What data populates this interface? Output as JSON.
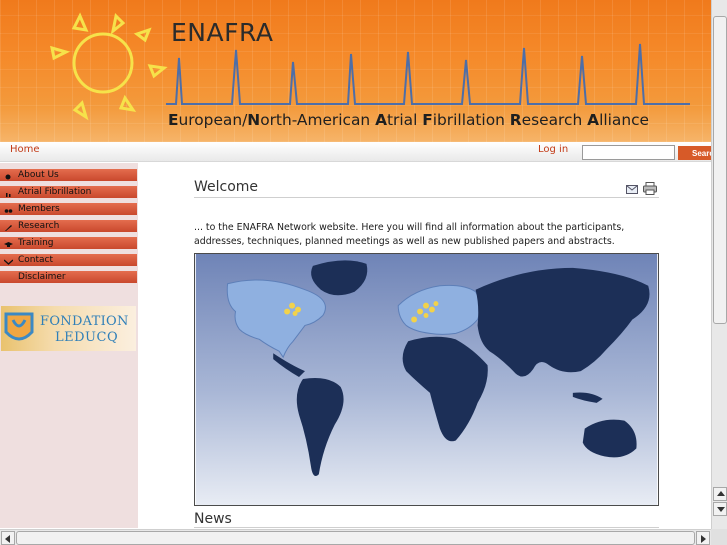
{
  "banner": {
    "title": "ENAFRA",
    "subtitle_parts": [
      {
        "bold": "E",
        "rest": "uropean/"
      },
      {
        "bold": "N",
        "rest": "orth-American "
      },
      {
        "bold": "A",
        "rest": "trial "
      },
      {
        "bold": "F",
        "rest": "ibrillation "
      },
      {
        "bold": "R",
        "rest": "esearch "
      },
      {
        "bold": "A",
        "rest": "lliance"
      }
    ]
  },
  "topbar": {
    "home": "Home",
    "login": "Log in",
    "search_value": "",
    "search_button": "Search"
  },
  "sidebar": {
    "items": [
      {
        "label": "About Us",
        "icon": "bullet-icon"
      },
      {
        "label": "Atrial Fibrillation",
        "icon": "chart-icon"
      },
      {
        "label": "Members",
        "icon": "members-icon"
      },
      {
        "label": "Research",
        "icon": "pen-icon"
      },
      {
        "label": "Training",
        "icon": "mortarboard-icon"
      },
      {
        "label": "Contact",
        "icon": "envelope-icon"
      },
      {
        "label": "Disclaimer",
        "icon": ""
      }
    ],
    "logo": {
      "line1": "FONDATION",
      "line2": "LEDUCQ"
    }
  },
  "main": {
    "heading": "Welcome",
    "intro": "... to the ENAFRA Network website. Here you will find all information about the participants, addresses, techniques, planned meetings as well as new published papers and abstracts.",
    "news_heading": "News"
  },
  "colors": {
    "banner_orange": "#f07a1c",
    "link_red": "#c23b17",
    "menu_red": "#d55a3c",
    "sidebar_bg": "#efdfdf",
    "map_ocean": "#7f93c0",
    "map_land": "#1c2f57",
    "map_highlight": "#8fb0e0"
  }
}
